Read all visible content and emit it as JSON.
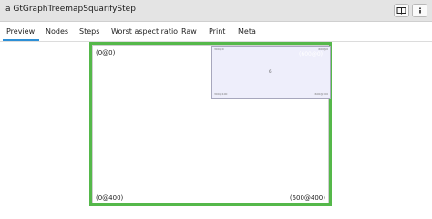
{
  "window": {
    "title": "a GtGraphTreemapSquarifyStep",
    "buttons": {
      "inspect_icon": "book-icon",
      "menu_icon": "menu-dot-icon"
    }
  },
  "tabs": [
    {
      "label": "Preview",
      "active": true
    },
    {
      "label": "Nodes",
      "active": false
    },
    {
      "label": "Steps",
      "active": false
    },
    {
      "label": "Worst aspect ratio",
      "active": false
    },
    {
      "label": "Raw",
      "active": false
    },
    {
      "label": "Print",
      "active": false
    },
    {
      "label": "Meta",
      "active": false
    }
  ],
  "preview": {
    "corners": {
      "top_left": "(0@0)",
      "bottom_left": "(0@400)",
      "bottom_right": "(600@400)"
    },
    "node": {
      "value": "6",
      "top_left": "300@0",
      "top_right": "600@0",
      "bottom_left": "300@100",
      "bottom_right": "600@100",
      "ghost_label": "(600@0)"
    },
    "colors": {
      "frame": "#55b84a",
      "node_fill": "#eeeefb",
      "tab_accent": "#2d8fd6"
    }
  }
}
